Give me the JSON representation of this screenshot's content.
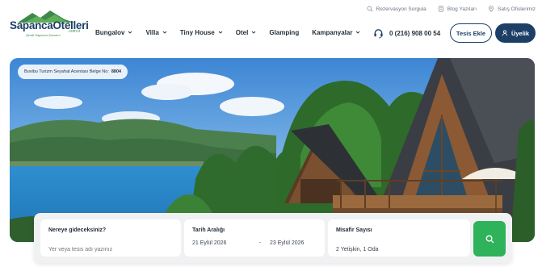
{
  "utility_links": [
    {
      "label": "Rezervasyon Sorgula",
      "icon": "search-icon"
    },
    {
      "label": "Blog Yazıları",
      "icon": "document-icon"
    },
    {
      "label": "Satış Ofislerimiz",
      "icon": "location-pin-icon"
    }
  ],
  "logo": {
    "name": "SapancaOtelleri",
    "domain": ".com.tr",
    "tagline": "Şimdi Sapanca Zamanı!"
  },
  "nav": {
    "items": [
      {
        "label": "Bungalov",
        "has_dropdown": true
      },
      {
        "label": "Villa",
        "has_dropdown": true
      },
      {
        "label": "Tiny House",
        "has_dropdown": true
      },
      {
        "label": "Otel",
        "has_dropdown": true
      },
      {
        "label": "Glamping",
        "has_dropdown": false
      },
      {
        "label": "Kampanyalar",
        "has_dropdown": true
      }
    ]
  },
  "contact": {
    "phone": "0 (216) 908 00 54",
    "icon": "headset-icon"
  },
  "header_buttons": {
    "add_facility": "Tesis Ekle",
    "membership": "Üyelik"
  },
  "hero": {
    "license_text": "Buvibu Turizm Seyahat Acentası Belge No:",
    "license_number": "8804"
  },
  "search": {
    "destination_label": "Nereye gideceksiniz?",
    "destination_placeholder": "Yer veya tesis adı yazınız",
    "date_label": "Tarih Aralığı",
    "date_start": "21 Eylül 2026",
    "date_separator": "-",
    "date_end": "23 Eylül 2026",
    "guests_label": "Misafir Sayısı",
    "guests_value": "2 Yetişkin, 1 Oda"
  },
  "colors": {
    "brand_navy": "#1d3f66",
    "brand_green": "#2eb25a",
    "text_dark": "#24303c"
  }
}
